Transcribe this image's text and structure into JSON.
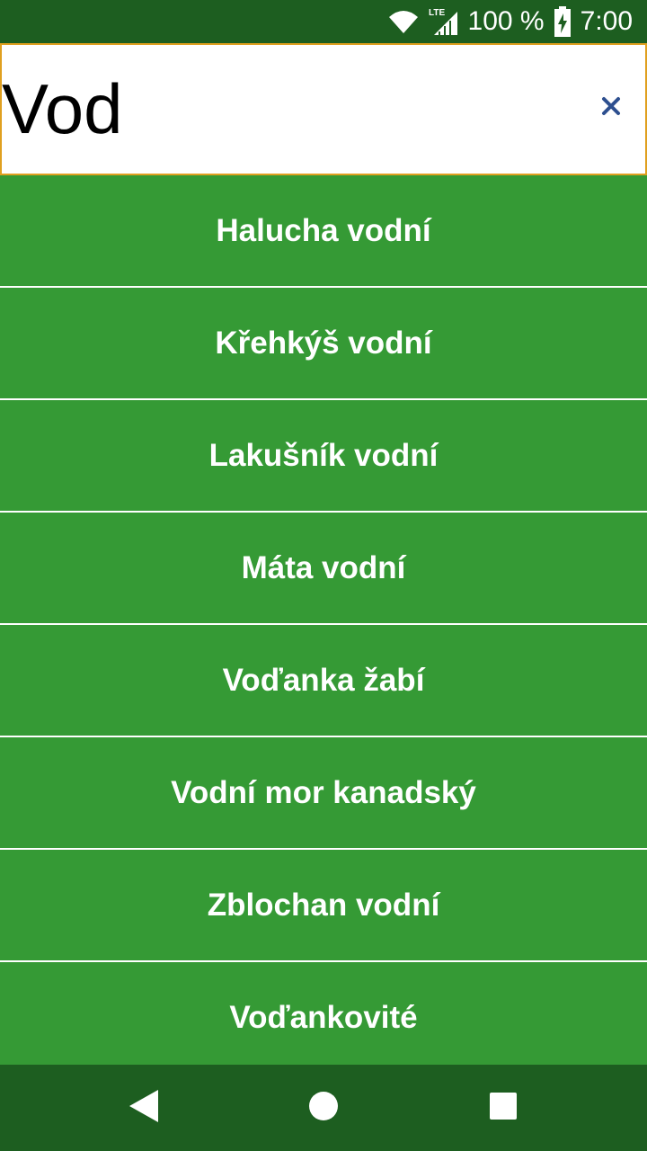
{
  "status_bar": {
    "network_label": "LTE",
    "battery_text": "100 %",
    "time": "7:00"
  },
  "search": {
    "value": "Vod",
    "clear_icon": "close-icon"
  },
  "results": [
    {
      "label": "Halucha vodní"
    },
    {
      "label": "Křehkýš vodní"
    },
    {
      "label": "Lakušník vodní"
    },
    {
      "label": "Máta vodní"
    },
    {
      "label": "Voďanka žabí"
    },
    {
      "label": "Vodní mor kanadský"
    },
    {
      "label": "Zblochan vodní"
    },
    {
      "label": "Voďankovité"
    }
  ],
  "nav_bar": {
    "back_icon": "back-triangle-icon",
    "home_icon": "home-circle-icon",
    "recents_icon": "recents-square-icon"
  },
  "colors": {
    "status_bar": "#1d5e20",
    "list_background": "#359a35",
    "search_border": "#e0a020",
    "clear_icon": "#2d4f8f"
  }
}
